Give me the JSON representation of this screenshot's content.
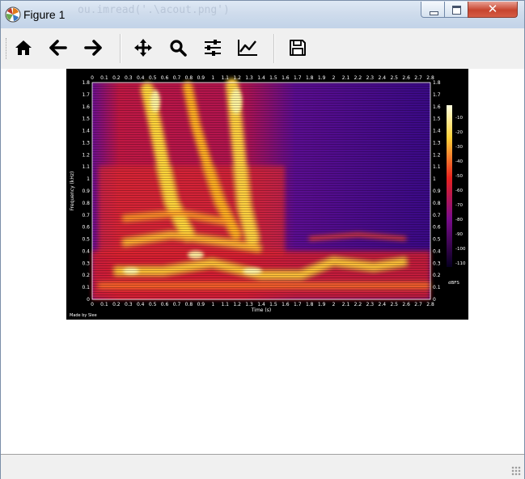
{
  "window": {
    "title": "Figure 1",
    "background_text": "ou.imread('.\\acout.png')",
    "close_glyph": "✕"
  },
  "toolbar": {
    "buttons": [
      {
        "name": "home-button",
        "icon": "home-icon"
      },
      {
        "name": "back-button",
        "icon": "arrow-left-icon"
      },
      {
        "name": "forward-button",
        "icon": "arrow-right-icon"
      },
      {
        "name": "pan-button",
        "icon": "move-icon"
      },
      {
        "name": "zoom-button",
        "icon": "magnifier-icon"
      },
      {
        "name": "subplots-button",
        "icon": "sliders-icon"
      },
      {
        "name": "edit-axes-button",
        "icon": "line-chart-icon"
      },
      {
        "name": "save-button",
        "icon": "floppy-disk-icon"
      }
    ]
  },
  "figure": {
    "title": "",
    "xlabel": "Time (s)",
    "ylabel": "Frequency (kHz)",
    "colorbar_unit": "dBFS",
    "corner_label": "Made by Slee",
    "x_ticks": [
      "0",
      "0.1",
      "0.2",
      "0.3",
      "0.4",
      "0.5",
      "0.6",
      "0.7",
      "0.8",
      "0.9",
      "1",
      "1.1",
      "1.2",
      "1.3",
      "1.4",
      "1.5",
      "1.6",
      "1.7",
      "1.8",
      "1.9",
      "2",
      "2.1",
      "2.2",
      "2.3",
      "2.4",
      "2.5",
      "2.6",
      "2.7",
      "2.8"
    ],
    "y_ticks": [
      "0",
      "0.1",
      "0.2",
      "0.3",
      "0.4",
      "0.5",
      "0.6",
      "0.7",
      "0.8",
      "0.9",
      "1",
      "1.1",
      "1.2",
      "1.3",
      "1.4",
      "1.5",
      "1.6",
      "1.7",
      "1.8"
    ],
    "colorbar_ticks": [
      "-10",
      "-20",
      "-30",
      "-40",
      "-50",
      "-60",
      "-70",
      "-80",
      "-90",
      "-100",
      "-110"
    ],
    "colors": {
      "low": "#000020",
      "mid": "#c81e3a",
      "high": "#ffffd0"
    }
  },
  "statusbar": {
    "message": ""
  }
}
